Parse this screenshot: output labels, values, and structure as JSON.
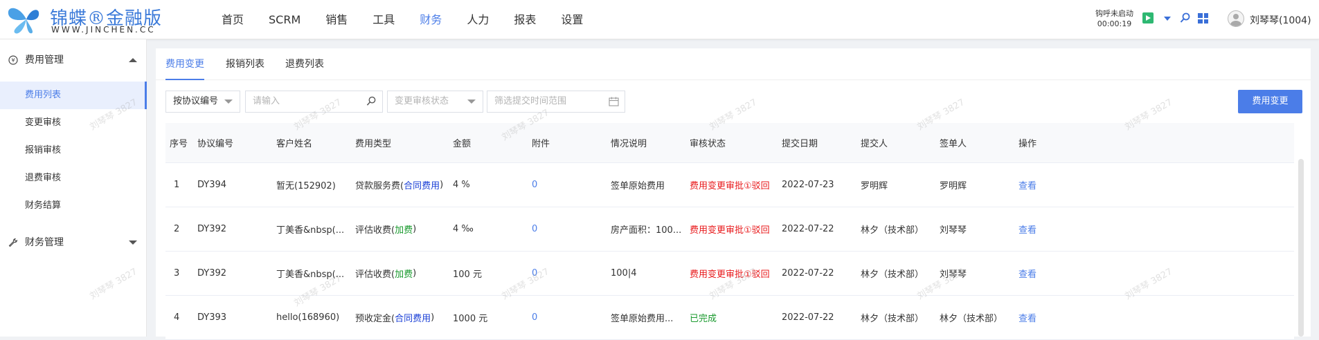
{
  "header": {
    "brand": "锦蝶®金融版",
    "url": "WWW.JINCHEN.CC",
    "nav": [
      "首页",
      "SCRM",
      "销售",
      "工具",
      "财务",
      "人力",
      "报表",
      "设置"
    ],
    "active_nav": "财务",
    "call_status": "钩呼未启动",
    "call_timer": "00:00:19",
    "username": "刘琴琴(1004)"
  },
  "sidebar": {
    "group1": "费用管理",
    "items": [
      "费用列表",
      "变更审核",
      "报销审核",
      "退费审核",
      "财务结算"
    ],
    "group2": "财务管理"
  },
  "tabs": [
    "费用变更",
    "报销列表",
    "退费列表"
  ],
  "filters": {
    "select_protocol": "按协议编号",
    "search_placeholder": "请输入",
    "status_placeholder": "变更审核状态",
    "date_placeholder": "筛选提交时间范围",
    "action_button": "费用变更"
  },
  "table": {
    "headers": [
      "序号",
      "协议编号",
      "客户姓名",
      "费用类型",
      "金额",
      "附件",
      "情况说明",
      "审核状态",
      "提交日期",
      "提交人",
      "签单人",
      "操作"
    ],
    "rows": [
      {
        "no": "1",
        "code": "DY394",
        "customer": "暂无(152902)",
        "fee_type": "贷款服务费(",
        "fee_tag": "合同费用",
        "fee_tail": ")",
        "amount": "4 %",
        "attach": "0",
        "note": "签单原始费用",
        "status": "费用变更审批①驳回",
        "date": "2022-07-23",
        "submitter": "罗明辉",
        "signer": "罗明辉",
        "op": "查看"
      },
      {
        "no": "2",
        "code": "DY392",
        "customer": "丁美香&nbsp(...",
        "fee_type": "评估收费(",
        "fee_tag": "加费",
        "fee_tail": ")",
        "amount": "4 ‰",
        "attach": "0",
        "note": "房产面积：100...",
        "status": "费用变更审批①驳回",
        "date": "2022-07-22",
        "submitter": "林夕（技术部）",
        "signer": "刘琴琴",
        "op": "查看"
      },
      {
        "no": "3",
        "code": "DY392",
        "customer": "丁美香&nbsp(...",
        "fee_type": "评估收费(",
        "fee_tag": "加费",
        "fee_tail": ")",
        "amount": "100 元",
        "attach": "0",
        "note": "100|4",
        "status": "费用变更审批①驳回",
        "date": "2022-07-22",
        "submitter": "林夕（技术部）",
        "signer": "刘琴琴",
        "op": "查看"
      },
      {
        "no": "4",
        "code": "DY393",
        "customer": "hello(168960)",
        "fee_type": "预收定金(",
        "fee_tag": "合同费用",
        "fee_tail": ")",
        "amount": "1000 元",
        "attach": "0",
        "note": "签单原始费用...",
        "status": "已完成",
        "date": "2022-07-22",
        "submitter": "林夕（技术部）",
        "signer": "林夕（技术部）",
        "op": "查看"
      }
    ]
  },
  "watermark": "刘琴琴 3827",
  "colors": {
    "accent": "#4b7de8",
    "reject": "#e8191b",
    "done": "#1a9a2e"
  }
}
